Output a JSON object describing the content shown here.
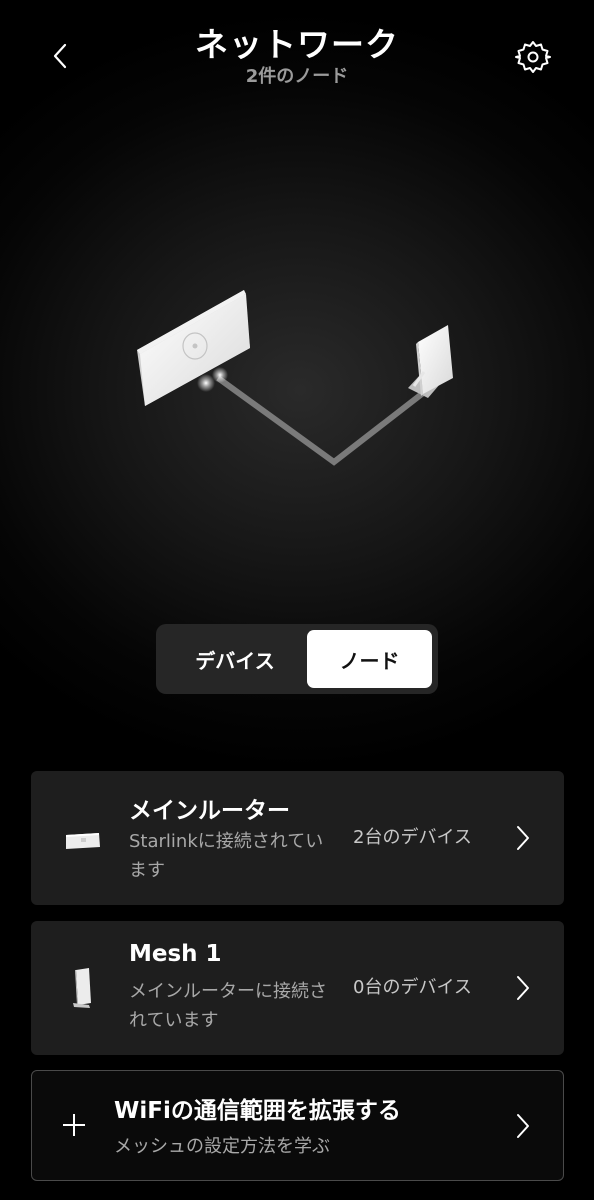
{
  "header": {
    "title": "ネットワーク",
    "subtitle": "2件のノード",
    "back_icon": "chevron-left-icon",
    "settings_icon": "gear-icon"
  },
  "tabs": [
    {
      "label": "デバイス",
      "selected": false
    },
    {
      "label": "ノード",
      "selected": true
    }
  ],
  "nodes": [
    {
      "name": "メインルーター",
      "status": "Starlinkに接続されています",
      "device_count": "2台のデバイス",
      "icon": "router-icon"
    },
    {
      "name": "Mesh 1",
      "status": "メインルーターに接続されています",
      "device_count": "0台のデバイス",
      "icon": "mesh-router-icon"
    }
  ],
  "extend": {
    "title": "WiFiの通信範囲を拡張する",
    "subtitle": "メッシュの設定方法を学ぶ",
    "icon": "plus-icon"
  },
  "colors": {
    "background": "#000000",
    "card": "#1e1e1e",
    "selected_tab": "#ffffff",
    "muted_text": "#a8a8a8"
  }
}
